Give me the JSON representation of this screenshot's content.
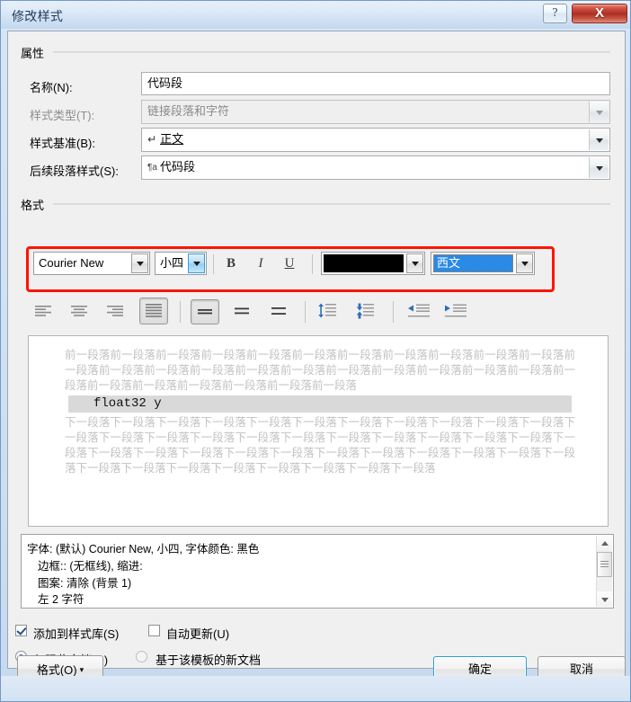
{
  "window": {
    "title": "修改样式",
    "help_label": "?",
    "close_label": "X"
  },
  "properties": {
    "group_label": "属性",
    "name": {
      "label": "名称(N):",
      "value": "代码段"
    },
    "style_type": {
      "label": "样式类型(T):",
      "value": "链接段落和字符",
      "disabled": true
    },
    "style_based_on": {
      "label": "样式基准(B):",
      "icon": "↵",
      "value": "正文"
    },
    "next_style": {
      "label": "后续段落样式(S):",
      "icon": "¶a",
      "value": "代码段"
    }
  },
  "format": {
    "group_label": "格式",
    "font_name": "Courier New",
    "font_size": "小四",
    "bold_label": "B",
    "italic_label": "I",
    "underline_label": "U",
    "font_color": "#000000",
    "script_value": "西文",
    "highlight_color": "#ff1400",
    "selection_color": "#2a8ae4",
    "align_icons": [
      "align-left-icon",
      "align-center-icon",
      "align-right-icon",
      "align-justify-icon"
    ],
    "spacing_icons": [
      "line-spacing-single-icon",
      "line-spacing-1-5-icon",
      "line-spacing-double-icon"
    ],
    "para_space_icons": [
      "space-before-icon",
      "space-after-icon"
    ],
    "indent_icons": [
      "decrease-indent-icon",
      "increase-indent-icon"
    ]
  },
  "preview": {
    "before_text": "前一段落前一段落前一段落前一段落前一段落前一段落前一段落前一段落前一段落前一段落前一段落前一段落前一段落前一段落前一段落前一段落前一段落前一段落前一段落前一段落前一段落前一段落前一段落前一段落前一段落前一段落前一段落前一段落前一段落",
    "sample_text": "float32 y",
    "after_text": "下一段落下一段落下一段落下一段落下一段落下一段落下一段落下一段落下一段落下一段落下一段落下一段落下一段落下一段落下一段落下一段落下一段落下一段落下一段落下一段落下一段落下一段落下一段落下一段落下一段落下一段落下一段落下一段落下一段落下一段落下一段落下一段落下一段落下一段落下一段落下一段落下一段落下一段落下一段落下一段落下一段落下一段落"
  },
  "description": {
    "lines": [
      "字体: (默认) Courier New, 小四, 字体颜色: 黑色",
      "边框:: (无框线), 缩进:",
      "图案: 清除 (背景 1)",
      "左  2 字符"
    ]
  },
  "options": {
    "add_to_gallery": {
      "label": "添加到样式库(S)",
      "checked": true
    },
    "auto_update": {
      "label": "自动更新(U)",
      "checked": false
    },
    "this_doc_only": {
      "label": "仅限此文档(D)",
      "selected": true
    },
    "new_docs_template": {
      "label": "基于该模板的新文档",
      "selected": false
    }
  },
  "footer": {
    "format_button": "格式(O)",
    "format_caret": "▾",
    "ok_button": "确定",
    "cancel_button": "取消"
  }
}
